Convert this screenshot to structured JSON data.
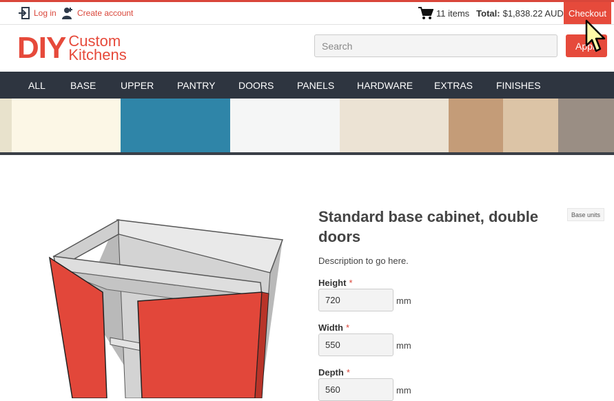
{
  "topbar": {
    "login_label": "Log in",
    "create_account_label": "Create account",
    "cart_items": "11 items",
    "total_label": "Total:",
    "total_value": "$1,838.22 AUD",
    "checkout_label": "Checkout"
  },
  "header": {
    "logo_main": "DIY",
    "logo_line1": "Custom",
    "logo_line2": "Kitchens",
    "search_placeholder": "Search",
    "apply_label": "Apply"
  },
  "nav": {
    "items": [
      "ALL",
      "BASE",
      "UPPER",
      "PANTRY",
      "DOORS",
      "PANELS",
      "HARDWARE",
      "EXTRAS",
      "FINISHES"
    ]
  },
  "colors": {
    "accent": "#e64a3b",
    "nav_bg": "#2e3540",
    "door": "#e2473a"
  },
  "swatches": [
    "#e8e2cc",
    "#fcf7e6",
    "#2f85a8",
    "#f5f6f6",
    "#ece3d4",
    "#c49c78",
    "#dcc4a6",
    "#9a8e84"
  ],
  "product": {
    "title": "Standard base cabinet, double doors",
    "category_badge": "Base units",
    "description": "Description to go here.",
    "fields": [
      {
        "label": "Height",
        "value": "720",
        "unit": "mm"
      },
      {
        "label": "Width",
        "value": "550",
        "unit": "mm"
      },
      {
        "label": "Depth",
        "value": "560",
        "unit": "mm"
      }
    ],
    "required_mark": "*"
  }
}
